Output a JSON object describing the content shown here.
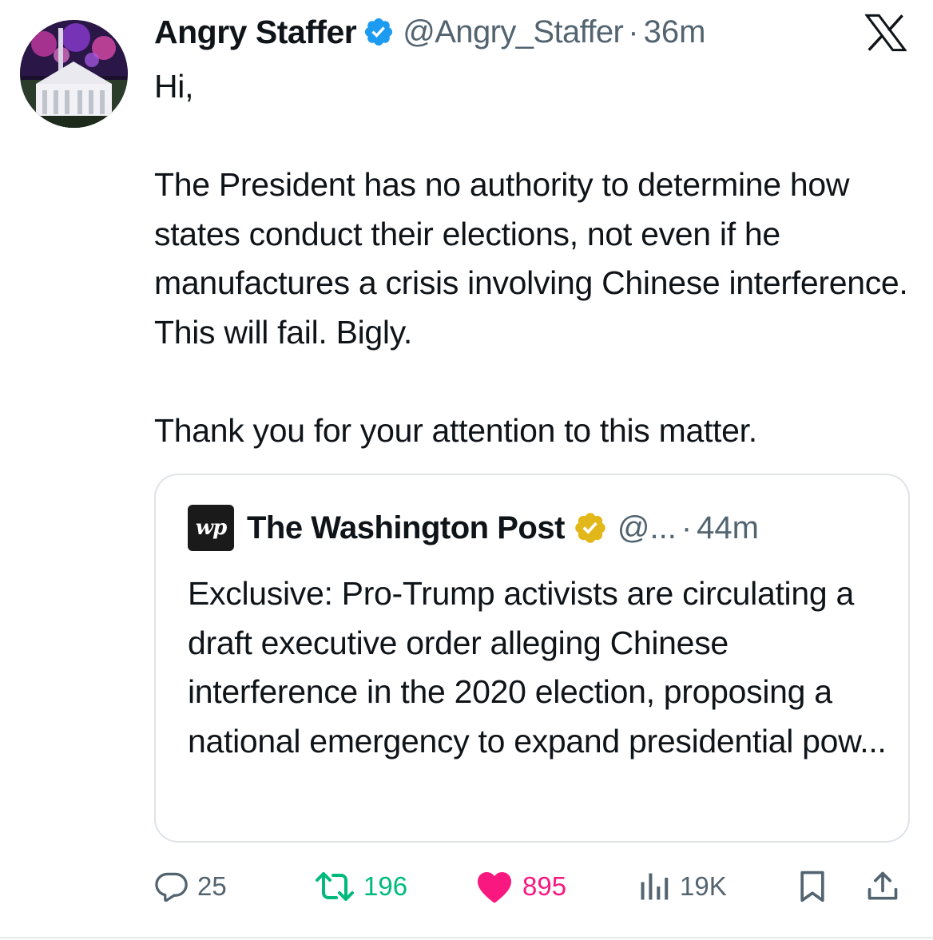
{
  "author": {
    "name": "Angry Staffer",
    "handle": "@Angry_Staffer",
    "separator": "·",
    "time": "36m"
  },
  "tweet": {
    "lines": [
      "Hi,",
      "The President has no authority to determine how states conduct their elections, not even if he manufactures a crisis involving Chinese interference. This will fail. Bigly.",
      "Thank you for your attention to this matter."
    ]
  },
  "quote": {
    "logo_text": "wp",
    "name": "The Washington Post",
    "handle": "@...",
    "separator": "·",
    "time": "44m",
    "text": "Exclusive: Pro-Trump activists are circulating a draft executive order alleging Chinese interference in the 2020 election, proposing a national emergency to expand presidential pow..."
  },
  "actions": {
    "replies": "25",
    "reposts": "196",
    "likes": "895",
    "views": "19K"
  },
  "colors": {
    "text": "#0f1419",
    "muted": "#536471",
    "verified_blue": "#1d9bf0",
    "verified_gold": "#e2b719",
    "repost_green": "#00ba7c",
    "like_pink": "#f91880"
  },
  "icons": {
    "close": "x-logo-icon",
    "reply": "reply-icon",
    "repost": "repost-icon",
    "like": "heart-icon",
    "views": "views-icon",
    "bookmark": "bookmark-icon",
    "share": "share-icon"
  }
}
